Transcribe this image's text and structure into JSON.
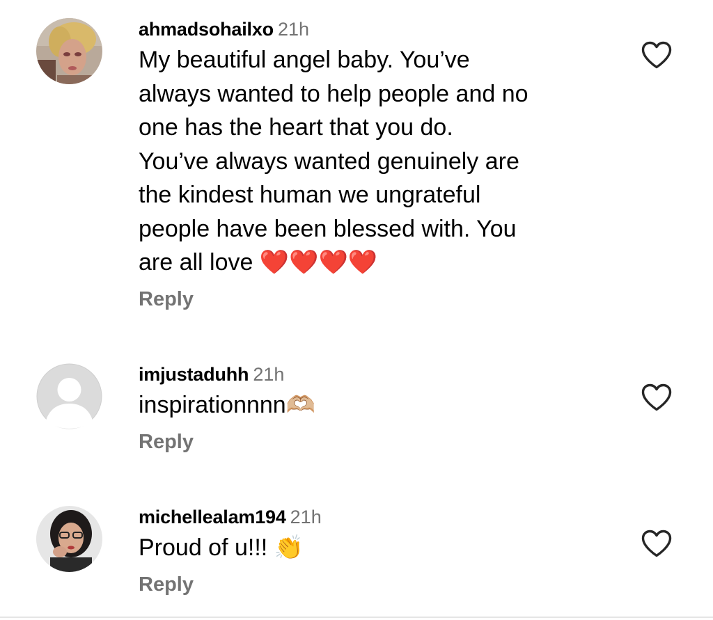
{
  "like_icon": "heart-outline-icon",
  "colors": {
    "text_primary": "#000000",
    "text_secondary": "#737373",
    "background": "#ffffff",
    "placeholder_avatar": "#dbdbdb"
  },
  "comments": [
    {
      "username": "ahmadsohailxo",
      "time": "21h",
      "text": "My beautiful angel baby. You’ve\nalways wanted to help people and no\none has the heart that you do.\nYou’ve always wanted genuinely are\nthe kindest human we ungrateful\npeople have been blessed with. You\nare all love ❤️❤️❤️❤️",
      "reply_label": "Reply",
      "avatar": "profile-photo"
    },
    {
      "username": "imjustaduhh",
      "time": "21h",
      "text": "inspirationnnn🫶🏼",
      "reply_label": "Reply",
      "avatar": "default-profile-placeholder"
    },
    {
      "username": "michellealam194",
      "time": "21h",
      "text": "Proud of u!!! 👏",
      "reply_label": "Reply",
      "avatar": "profile-photo"
    }
  ]
}
